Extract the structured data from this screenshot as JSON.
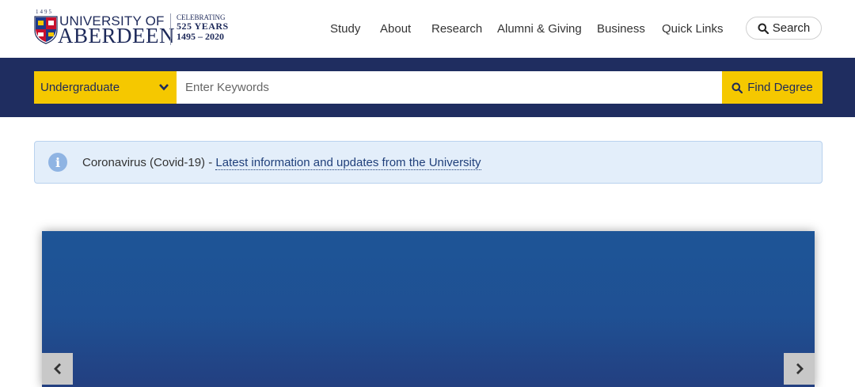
{
  "logo": {
    "year_small": "1495",
    "name_line1": "UNIVERSITY OF",
    "name_line2": "ABERDEEN",
    "celebrating": "CELEBRATING",
    "years": "525 YEARS",
    "range": "1495 – 2020"
  },
  "nav": {
    "items": [
      {
        "label": "Study"
      },
      {
        "label": "About"
      },
      {
        "label": "Research"
      },
      {
        "label": "Alumni & Giving"
      },
      {
        "label": "Business"
      },
      {
        "label": "Quick Links"
      }
    ],
    "search_label": "Search"
  },
  "degree_search": {
    "level_selected": "Undergraduate",
    "keyword_placeholder": "Enter Keywords",
    "keyword_value": "",
    "button_label": "Find Degree"
  },
  "alert": {
    "text": "Coronavirus (Covid-19) - ",
    "link_text": "Latest information and updates from the University"
  },
  "icons": {
    "crest": "crest-icon",
    "search": "search-icon",
    "chevron": "chevron-down-icon",
    "info": "info-icon",
    "prev": "chevron-left-icon",
    "next": "chevron-right-icon"
  },
  "colors": {
    "navy": "#1f2d60",
    "gold": "#f5c800",
    "hero_blue": "#1e5597",
    "alert_bg": "#e3eefa"
  }
}
